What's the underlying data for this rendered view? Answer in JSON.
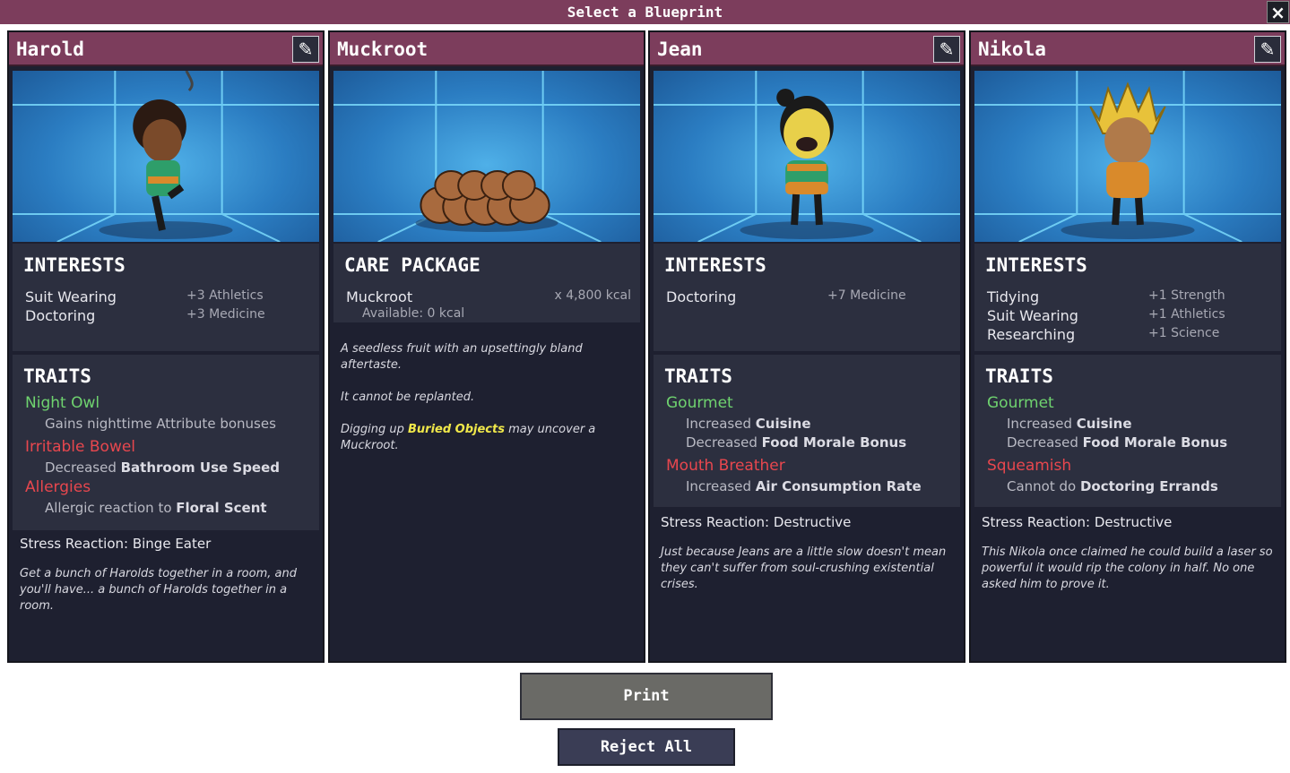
{
  "window": {
    "title": "Select a Blueprint",
    "close_icon": "×"
  },
  "colors": {
    "header": "#7c3d5c",
    "card_bg": "#1e2030",
    "section_bg": "#2c2f3f",
    "positive_trait": "#6fd36f",
    "negative_trait": "#e8474e",
    "highlight": "#f0e84a"
  },
  "cards": [
    {
      "name": "Harold",
      "edit_icon": "✎",
      "interests_title": "INTERESTS",
      "interests": [
        {
          "label": "Suit Wearing",
          "value": "+3 Athletics"
        },
        {
          "label": "Doctoring",
          "value": "+3 Medicine"
        }
      ],
      "traits_title": "TRAITS",
      "traits": [
        {
          "name": "Night Owl",
          "desc_pre": "Gains nighttime Attribute bonuses",
          "desc_bold": ""
        },
        {
          "name": "Irritable Bowel",
          "desc_pre": "Decreased ",
          "desc_bold": "Bathroom Use Speed"
        },
        {
          "name": "Allergies",
          "desc_pre": "Allergic reaction to ",
          "desc_bold": "Floral Scent"
        }
      ],
      "stress": "Stress Reaction: Binge Eater",
      "bio": "Get a bunch of Harolds together in a room, and you'll have... a bunch of Harolds together in a room."
    },
    {
      "name": "Muckroot",
      "package_title": "CARE PACKAGE",
      "item_name": "Muckroot",
      "item_qty": "x 4,800 kcal",
      "available": "Available: 0 kcal",
      "desc1": "A seedless fruit with an upsettingly bland aftertaste.",
      "desc2": "It cannot be replanted.",
      "desc3_pre": "Digging up ",
      "desc3_link": "Buried Objects",
      "desc3_post": " may uncover a Muckroot."
    },
    {
      "name": "Jean",
      "edit_icon": "✎",
      "interests_title": "INTERESTS",
      "interests": [
        {
          "label": "Doctoring",
          "value": "+7 Medicine"
        }
      ],
      "traits_title": "TRAITS",
      "traits": [
        {
          "name": "Gourmet",
          "desc1_pre": "Increased ",
          "desc1_bold": "Cuisine",
          "desc2_pre": "Decreased ",
          "desc2_bold": "Food Morale Bonus"
        },
        {
          "name": "Mouth Breather",
          "desc1_pre": "Increased ",
          "desc1_bold": "Air Consumption Rate"
        }
      ],
      "stress": "Stress Reaction: Destructive",
      "bio": "Just because Jeans are a little slow doesn't mean they can't suffer from soul-crushing existential crises."
    },
    {
      "name": "Nikola",
      "edit_icon": "✎",
      "interests_title": "INTERESTS",
      "interests": [
        {
          "label": "Tidying",
          "value": "+1 Strength"
        },
        {
          "label": "Suit Wearing",
          "value": "+1 Athletics"
        },
        {
          "label": "Researching",
          "value": "+1 Science"
        }
      ],
      "traits_title": "TRAITS",
      "traits": [
        {
          "name": "Gourmet",
          "desc1_pre": "Increased ",
          "desc1_bold": "Cuisine",
          "desc2_pre": "Decreased ",
          "desc2_bold": "Food Morale Bonus"
        },
        {
          "name": "Squeamish",
          "desc1_pre": "Cannot do ",
          "desc1_bold": "Doctoring Errands"
        }
      ],
      "stress": "Stress Reaction: Destructive",
      "bio": "This Nikola once claimed he could build a laser so powerful it would rip the colony in half. No one asked him to prove it."
    }
  ],
  "buttons": {
    "print": "Print",
    "reject": "Reject All"
  }
}
